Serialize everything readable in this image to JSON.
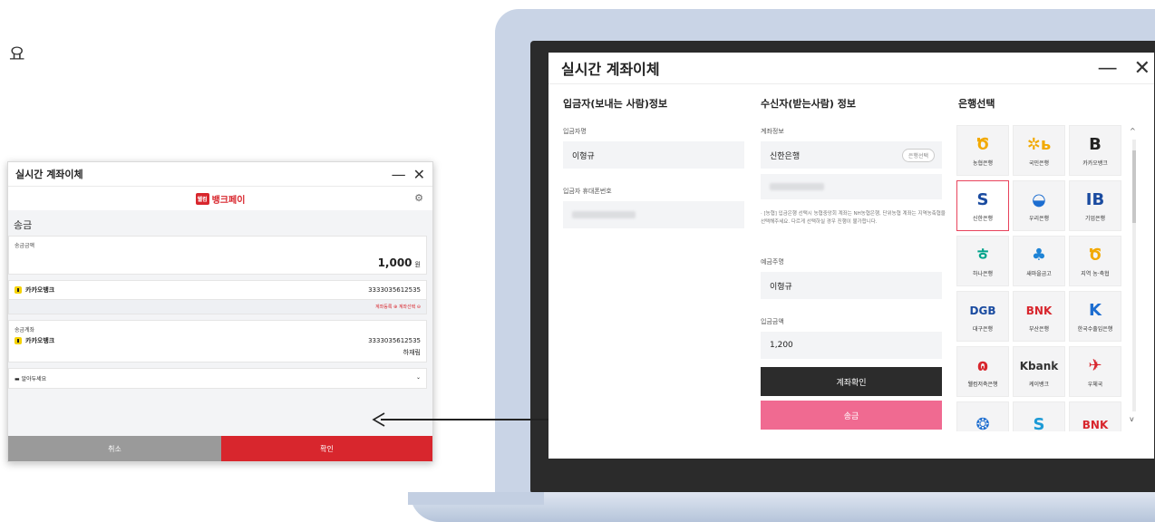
{
  "bg_fragment": "요",
  "mini": {
    "title": "실시간 계좌이체",
    "minimize": "—",
    "close": "✕",
    "brand_badge": "웰컴",
    "brand_name": "뱅크페이",
    "gear_icon": "⚙",
    "section_title": "송금",
    "amount_label": "송금금액",
    "amount_value": "1,000",
    "amount_unit": "원",
    "from_bank": "카카오뱅크",
    "from_account": "3333035612535",
    "links": "계좌등록 ⊕  계좌선택 ⊖",
    "to_label": "송금계좌",
    "to_bank": "카카오뱅크",
    "to_account": "3333035612535",
    "to_name": "하재림",
    "notice_label": "알아두세요",
    "chevron": "⌄",
    "cancel": "취소",
    "confirm": "확인"
  },
  "main": {
    "title": "실시간 계좌이체",
    "minimize": "—",
    "close": "✕",
    "sender_header": "입금자(보내는 사람)정보",
    "sender_name_label": "입금자명",
    "sender_name": "이형규",
    "sender_phone_label": "입금자 휴대폰번호",
    "receiver_header": "수신자(받는사람) 정보",
    "account_info_label": "계좌정보",
    "account_bank": "신한은행",
    "bank_select_pill": "은행선택",
    "notice": "· [농협] 입금은행 선택시 농협중앙회 계좌는 NH농협은행, 단위농협 계좌는 지역농축협을 선택해주세요. 다르게 선택하실 경우 진행이 불가합니다.",
    "holder_label": "예금주명",
    "holder_value": "이형규",
    "amount_label": "입금금액",
    "amount_value": "1,200",
    "verify_button": "계좌확인",
    "send_button": "송금",
    "bank_header": "은행선택",
    "banks": [
      {
        "label": "농협은행",
        "logo": "Ծ",
        "color": "#f2a900"
      },
      {
        "label": "국민은행",
        "logo": "✲ь",
        "color": "#f2a900"
      },
      {
        "label": "카카오뱅크",
        "logo": "B",
        "color": "#222222"
      },
      {
        "label": "신한은행",
        "logo": "S",
        "color": "#1a4ba0"
      },
      {
        "label": "우리은행",
        "logo": "◒",
        "color": "#1c6dd0"
      },
      {
        "label": "기업은행",
        "logo": "IB",
        "color": "#1a4ba0"
      },
      {
        "label": "하나은행",
        "logo": "ㅎ",
        "color": "#00a38b"
      },
      {
        "label": "새마을금고",
        "logo": "♣",
        "color": "#1f84d6"
      },
      {
        "label": "지역 농·축협",
        "logo": "Ծ",
        "color": "#f2a900"
      },
      {
        "label": "대구은행",
        "logo": "DGB",
        "color": "#1a4ba0"
      },
      {
        "label": "부산은행",
        "logo": "BNK",
        "color": "#d8262d"
      },
      {
        "label": "한국수출입은행",
        "logo": "K",
        "color": "#1c6dd0"
      },
      {
        "label": "웰컴저축은행",
        "logo": "ɷ",
        "color": "#d8262d"
      },
      {
        "label": "케이뱅크",
        "logo": "Kbank",
        "color": "#333333"
      },
      {
        "label": "우체국",
        "logo": "✈",
        "color": "#d8262d"
      },
      {
        "label": "",
        "logo": "❂",
        "color": "#1c6dd0"
      },
      {
        "label": "",
        "logo": "S",
        "color": "#1c9ad6"
      },
      {
        "label": "",
        "logo": "BNK",
        "color": "#d8262d"
      }
    ],
    "scroll_up": "^",
    "scroll_down": "v"
  }
}
